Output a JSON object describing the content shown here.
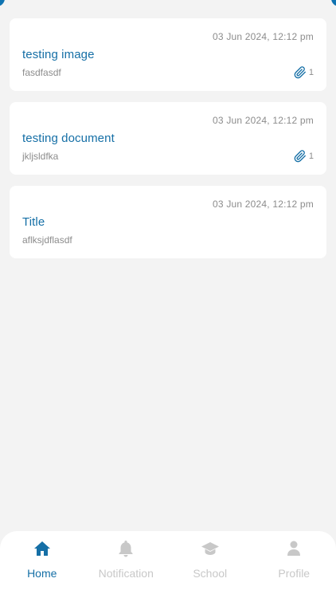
{
  "colors": {
    "accent": "#156fa6",
    "muted_text": "#8c8c8c",
    "inactive_nav": "#c8c8c8",
    "background": "#f3f3f3",
    "card": "#ffffff"
  },
  "announcements": [
    {
      "date": "03 Jun 2024, 12:12 pm",
      "title": "testing image",
      "description": "fasdfasdf",
      "attachment_icon": "paperclip-icon",
      "attachment_count": "1"
    },
    {
      "date": "03 Jun 2024, 12:12 pm",
      "title": "testing document",
      "description": "jkljsldfka",
      "attachment_icon": "paperclip-icon",
      "attachment_count": "1"
    },
    {
      "date": "03 Jun 2024, 12:12 pm",
      "title": "Title",
      "description": "aflksjdflasdf"
    }
  ],
  "bottom_nav": {
    "items": [
      {
        "label": "Home",
        "icon": "home-icon",
        "active": true
      },
      {
        "label": "Notification",
        "icon": "bell-icon",
        "active": false
      },
      {
        "label": "School",
        "icon": "graduation-cap-icon",
        "active": false
      },
      {
        "label": "Profile",
        "icon": "person-icon",
        "active": false
      }
    ]
  }
}
